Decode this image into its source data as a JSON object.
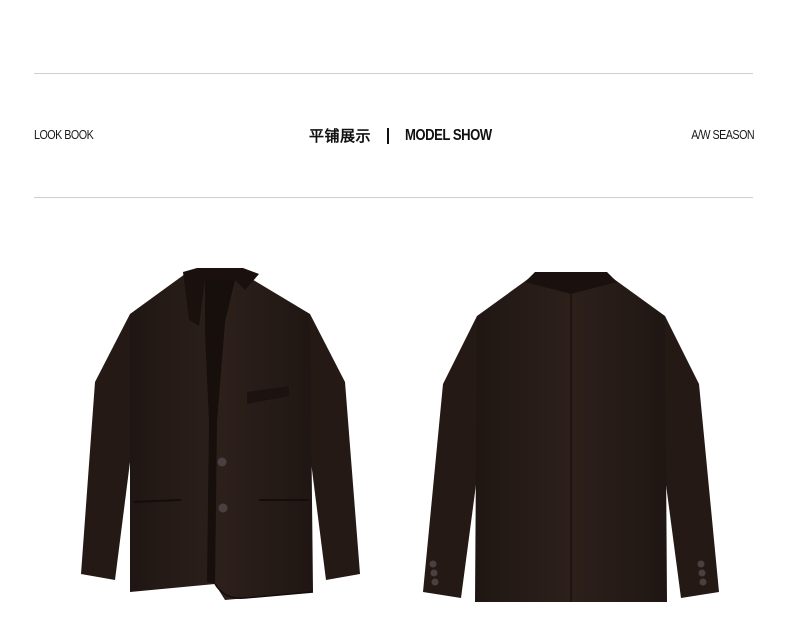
{
  "header": {
    "left_label": "LOOK BOOK",
    "title_cn": "平铺展示",
    "title_en": "MODEL SHOW",
    "right_label": "A/W SEASON"
  },
  "colors": {
    "jacket": "#2b1e1a",
    "jacket_shadow": "#1c1310",
    "rule": "#cfcfcf"
  }
}
